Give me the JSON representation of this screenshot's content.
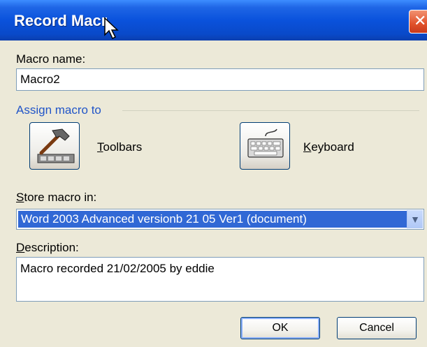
{
  "window": {
    "title": "Record Macro",
    "title_visible": "Record Macr",
    "close_glyph": "✕"
  },
  "macro_name": {
    "label": "Macro name:",
    "value": "Macro2"
  },
  "assign": {
    "title": "Assign macro to",
    "toolbars_label": "Toolbars",
    "keyboard_label": "Keyboard"
  },
  "store": {
    "label": "Store macro in:",
    "value": "Word 2003 Advanced versionb 21 05 Ver1 (document)"
  },
  "description": {
    "label": "Description:",
    "value": "Macro recorded 21/02/2005 by eddie"
  },
  "buttons": {
    "ok": "OK",
    "cancel": "Cancel"
  },
  "icons": [
    "close-icon",
    "cursor-icon",
    "hammer-toolbar-icon",
    "keyboard-icon",
    "chevron-down-icon"
  ],
  "colors": {
    "titlebar": "#0a52dc",
    "selection": "#3168d5",
    "group_title": "#2155c8",
    "dialog_bg": "#ece9d8"
  }
}
